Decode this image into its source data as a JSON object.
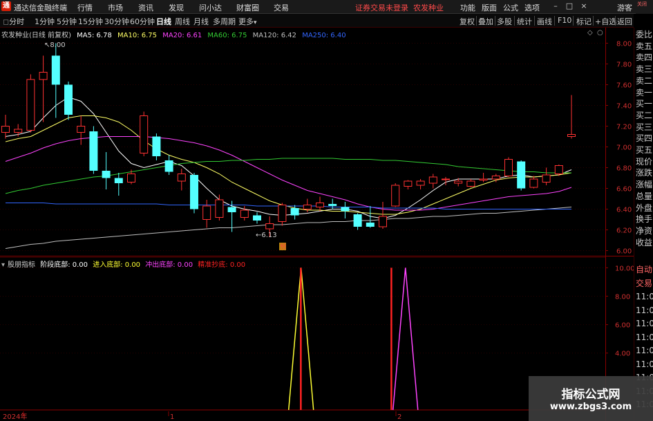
{
  "app": {
    "title": "通达信金融终端",
    "menu": [
      "行情",
      "市场",
      "资讯",
      "发现",
      "问小达",
      "财富圈",
      "交易"
    ],
    "notice": "证券交易未登录",
    "stock_name": "农发种业",
    "right_menu": [
      "功能",
      "版面",
      "公式",
      "选项"
    ],
    "guest": "游客"
  },
  "toolbar": {
    "periods": [
      "分时",
      "1分钟",
      "5分钟",
      "15分钟",
      "30分钟",
      "60分钟",
      "日线",
      "周线",
      "月线",
      "多周期",
      "更多"
    ],
    "active_period": "日线",
    "tools": [
      "复权",
      "叠加",
      "多股",
      "统计",
      "画线",
      "F10",
      "标记",
      "+自选",
      "返回"
    ]
  },
  "main_chart": {
    "title": "农发种业(日线 前复权)",
    "ma": [
      {
        "label": "MA5: 6.78",
        "color": "#ffffff"
      },
      {
        "label": "MA10: 6.75",
        "color": "#ffff66"
      },
      {
        "label": "MA20: 6.61",
        "color": "#ff44ff"
      },
      {
        "label": "MA60: 6.75",
        "color": "#33cc33"
      },
      {
        "label": "MA120: 6.42",
        "color": "#c0c0c0"
      },
      {
        "label": "MA250: 6.40",
        "color": "#3366ff"
      }
    ],
    "high_label": "8.00",
    "low_label": "6.13",
    "marker": "预"
  },
  "chart_data": [
    {
      "type": "candlestick",
      "title": "农发种业(日线 前复权)",
      "y_ticks": [
        "8.00",
        "7.80",
        "7.60",
        "7.40",
        "7.20",
        "7.00",
        "6.80",
        "6.60",
        "6.40",
        "6.20",
        "6.00"
      ],
      "ylim": [
        5.95,
        8.15
      ],
      "candles": [
        {
          "o": 7.14,
          "c": 7.2,
          "h": 7.31,
          "l": 7.08
        },
        {
          "o": 7.14,
          "c": 7.17,
          "h": 7.22,
          "l": 7.1
        },
        {
          "o": 7.16,
          "c": 7.65,
          "h": 7.7,
          "l": 7.14
        },
        {
          "o": 7.65,
          "c": 7.72,
          "h": 7.88,
          "l": 7.24
        },
        {
          "o": 7.88,
          "c": 7.6,
          "h": 8.0,
          "l": 7.28
        },
        {
          "o": 7.6,
          "c": 7.31,
          "h": 7.63,
          "l": 7.26
        },
        {
          "o": 7.14,
          "c": 7.2,
          "h": 7.3,
          "l": 7.02
        },
        {
          "o": 7.15,
          "c": 6.77,
          "h": 7.2,
          "l": 6.74
        },
        {
          "o": 6.77,
          "c": 6.7,
          "h": 6.95,
          "l": 6.59
        },
        {
          "o": 6.7,
          "c": 6.65,
          "h": 6.75,
          "l": 6.53
        },
        {
          "o": 6.66,
          "c": 6.74,
          "h": 6.78,
          "l": 6.64
        },
        {
          "o": 6.94,
          "c": 7.3,
          "h": 7.34,
          "l": 6.91
        },
        {
          "o": 7.1,
          "c": 6.91,
          "h": 7.13,
          "l": 6.87
        },
        {
          "o": 6.87,
          "c": 6.76,
          "h": 6.92,
          "l": 6.73
        },
        {
          "o": 6.67,
          "c": 6.74,
          "h": 6.79,
          "l": 6.58
        },
        {
          "o": 6.73,
          "c": 6.4,
          "h": 6.75,
          "l": 6.36
        },
        {
          "o": 6.3,
          "c": 6.43,
          "h": 6.49,
          "l": 6.22
        },
        {
          "o": 6.32,
          "c": 6.49,
          "h": 6.54,
          "l": 6.29
        },
        {
          "o": 6.42,
          "c": 6.37,
          "h": 6.48,
          "l": 6.18
        },
        {
          "o": 6.32,
          "c": 6.39,
          "h": 6.43,
          "l": 6.29
        },
        {
          "o": 6.34,
          "c": 6.29,
          "h": 6.37,
          "l": 6.26
        },
        {
          "o": 6.21,
          "c": 6.26,
          "h": 6.33,
          "l": 6.13
        },
        {
          "o": 6.28,
          "c": 6.44,
          "h": 6.46,
          "l": 6.24
        },
        {
          "o": 6.41,
          "c": 6.34,
          "h": 6.44,
          "l": 6.3
        },
        {
          "o": 6.4,
          "c": 6.44,
          "h": 6.5,
          "l": 6.37
        },
        {
          "o": 6.42,
          "c": 6.46,
          "h": 6.52,
          "l": 6.38
        },
        {
          "o": 6.45,
          "c": 6.43,
          "h": 6.5,
          "l": 6.4
        },
        {
          "o": 6.42,
          "c": 6.38,
          "h": 6.47,
          "l": 6.31
        },
        {
          "o": 6.35,
          "c": 6.23,
          "h": 6.36,
          "l": 6.2
        },
        {
          "o": 6.27,
          "c": 6.23,
          "h": 6.43,
          "l": 6.22
        },
        {
          "o": 6.23,
          "c": 6.33,
          "h": 6.47,
          "l": 6.21
        },
        {
          "o": 6.43,
          "c": 6.63,
          "h": 6.65,
          "l": 6.42
        },
        {
          "o": 6.62,
          "c": 6.67,
          "h": 6.68,
          "l": 6.59
        },
        {
          "o": 6.63,
          "c": 6.67,
          "h": 6.69,
          "l": 6.59
        },
        {
          "o": 6.65,
          "c": 6.71,
          "h": 6.74,
          "l": 6.6
        },
        {
          "o": 6.69,
          "c": 6.69,
          "h": 6.71,
          "l": 6.63
        },
        {
          "o": 6.65,
          "c": 6.67,
          "h": 6.7,
          "l": 6.62
        },
        {
          "o": 6.62,
          "c": 6.67,
          "h": 6.69,
          "l": 6.61
        },
        {
          "o": 6.68,
          "c": 6.69,
          "h": 6.75,
          "l": 6.66
        },
        {
          "o": 6.69,
          "c": 6.72,
          "h": 6.74,
          "l": 6.66
        },
        {
          "o": 6.72,
          "c": 6.88,
          "h": 6.9,
          "l": 6.71
        },
        {
          "o": 6.86,
          "c": 6.6,
          "h": 6.87,
          "l": 6.58
        },
        {
          "o": 6.61,
          "c": 6.69,
          "h": 6.72,
          "l": 6.6
        },
        {
          "o": 6.66,
          "c": 6.73,
          "h": 6.8,
          "l": 6.63
        },
        {
          "o": 6.74,
          "c": 6.82,
          "h": 6.83,
          "l": 6.72
        },
        {
          "o": 7.1,
          "c": 7.12,
          "h": 7.5,
          "l": 7.08
        }
      ],
      "series": [
        {
          "name": "MA5",
          "color": "#ffffff",
          "values": [
            7.1,
            7.12,
            7.15,
            7.28,
            7.4,
            7.48,
            7.44,
            7.32,
            7.14,
            6.96,
            6.84,
            6.8,
            6.83,
            6.86,
            6.82,
            6.72,
            6.6,
            6.49,
            6.43,
            6.4,
            6.38,
            6.35,
            6.34,
            6.35,
            6.36,
            6.38,
            6.4,
            6.4,
            6.38,
            6.33,
            6.31,
            6.34,
            6.41,
            6.49,
            6.58,
            6.66,
            6.69,
            6.69,
            6.69,
            6.69,
            6.72,
            6.73,
            6.71,
            6.72,
            6.73,
            6.78
          ]
        },
        {
          "name": "MA10",
          "color": "#ffff66",
          "values": [
            7.05,
            7.08,
            7.1,
            7.16,
            7.22,
            7.28,
            7.3,
            7.3,
            7.28,
            7.24,
            7.16,
            7.06,
            6.98,
            6.92,
            6.88,
            6.85,
            6.8,
            6.74,
            6.66,
            6.6,
            6.54,
            6.48,
            6.44,
            6.41,
            6.39,
            6.39,
            6.38,
            6.38,
            6.37,
            6.36,
            6.35,
            6.35,
            6.37,
            6.4,
            6.45,
            6.5,
            6.55,
            6.6,
            6.64,
            6.68,
            6.7,
            6.71,
            6.71,
            6.72,
            6.73,
            6.75
          ]
        },
        {
          "name": "MA20",
          "color": "#ff44ff",
          "values": [
            6.86,
            6.9,
            6.94,
            6.99,
            7.03,
            7.06,
            7.08,
            7.09,
            7.1,
            7.1,
            7.1,
            7.1,
            7.09,
            7.08,
            7.06,
            7.04,
            7.01,
            6.97,
            6.92,
            6.86,
            6.8,
            6.74,
            6.68,
            6.63,
            6.58,
            6.55,
            6.52,
            6.49,
            6.45,
            6.42,
            6.4,
            6.39,
            6.39,
            6.39,
            6.4,
            6.42,
            6.44,
            6.46,
            6.48,
            6.5,
            6.52,
            6.53,
            6.54,
            6.55,
            6.57,
            6.61
          ]
        },
        {
          "name": "MA60",
          "color": "#33cc33",
          "values": [
            6.55,
            6.58,
            6.6,
            6.63,
            6.65,
            6.67,
            6.69,
            6.71,
            6.72,
            6.74,
            6.76,
            6.78,
            6.8,
            6.82,
            6.84,
            6.85,
            6.86,
            6.86,
            6.87,
            6.87,
            6.88,
            6.88,
            6.89,
            6.89,
            6.89,
            6.89,
            6.89,
            6.88,
            6.88,
            6.88,
            6.87,
            6.87,
            6.86,
            6.85,
            6.84,
            6.83,
            6.81,
            6.8,
            6.79,
            6.78,
            6.77,
            6.76,
            6.76,
            6.75,
            6.75,
            6.75
          ]
        },
        {
          "name": "MA120",
          "color": "#c0c0c0",
          "values": [
            6.02,
            6.04,
            6.06,
            6.07,
            6.09,
            6.1,
            6.11,
            6.12,
            6.13,
            6.14,
            6.15,
            6.16,
            6.17,
            6.18,
            6.19,
            6.2,
            6.21,
            6.22,
            6.22,
            6.23,
            6.24,
            6.25,
            6.25,
            6.26,
            6.27,
            6.27,
            6.28,
            6.28,
            6.29,
            6.29,
            6.3,
            6.31,
            6.31,
            6.32,
            6.33,
            6.33,
            6.34,
            6.35,
            6.36,
            6.36,
            6.37,
            6.38,
            6.39,
            6.4,
            6.41,
            6.42
          ]
        },
        {
          "name": "MA250",
          "color": "#3366ff",
          "values": [
            6.46,
            6.46,
            6.46,
            6.46,
            6.45,
            6.45,
            6.45,
            6.45,
            6.45,
            6.45,
            6.45,
            6.45,
            6.45,
            6.44,
            6.44,
            6.44,
            6.44,
            6.44,
            6.44,
            6.44,
            6.43,
            6.43,
            6.43,
            6.43,
            6.43,
            6.43,
            6.42,
            6.42,
            6.42,
            6.42,
            6.41,
            6.41,
            6.41,
            6.41,
            6.41,
            6.4,
            6.4,
            6.4,
            6.4,
            6.4,
            6.4,
            6.4,
            6.4,
            6.4,
            6.4,
            6.4
          ]
        }
      ]
    },
    {
      "type": "line",
      "title": "股朋指标",
      "y_ticks": [
        "10.00",
        "8.00",
        "6.00",
        "4.00"
      ],
      "ylim": [
        0,
        10.6
      ],
      "x_ticks": [
        "2024年",
        "1",
        "2"
      ],
      "series": [
        {
          "name": "阶段底部",
          "color": "#ffffff",
          "values": []
        },
        {
          "name": "进入底部",
          "color": "#ffff33",
          "spike": {
            "index": 23.5,
            "value": 10
          }
        },
        {
          "name": "冲出底部",
          "color": "#ff44ff",
          "spike": {
            "index": 31.8,
            "value": 10
          }
        },
        {
          "name": "精准抄底",
          "color": "#ff2222",
          "bars": [
            {
              "index": 23.7,
              "value": 10
            },
            {
              "index": 30.9,
              "value": 10
            }
          ]
        }
      ]
    }
  ],
  "indicator": {
    "name": "股朋指标",
    "items": [
      {
        "label": "阶段底部: 0.00",
        "color": "#ffffff"
      },
      {
        "label": "进入底部: 0.00",
        "color": "#ffff33"
      },
      {
        "label": "冲出底部: 0.00",
        "color": "#ff44ff"
      },
      {
        "label": "精准抄底: 0.00",
        "color": "#ff2222"
      }
    ]
  },
  "right_panel": {
    "top": "关闭",
    "items": [
      "委比",
      "卖五",
      "卖四",
      "卖三",
      "卖二",
      "卖一",
      "买一",
      "买二",
      "买三",
      "买四",
      "买五",
      "现价",
      "涨跌",
      "涨幅",
      "总量",
      "外盘",
      "换手",
      "净资",
      "收益"
    ],
    "bottom_items": [
      "自动",
      "交易",
      "11:0",
      "11:0",
      "11:0",
      "11:0",
      "11:0",
      "11:0",
      "11:0",
      "11:0",
      "11:0"
    ]
  },
  "watermark": {
    "line1": "指标公式网",
    "line2": "www.zbgs3.com"
  }
}
